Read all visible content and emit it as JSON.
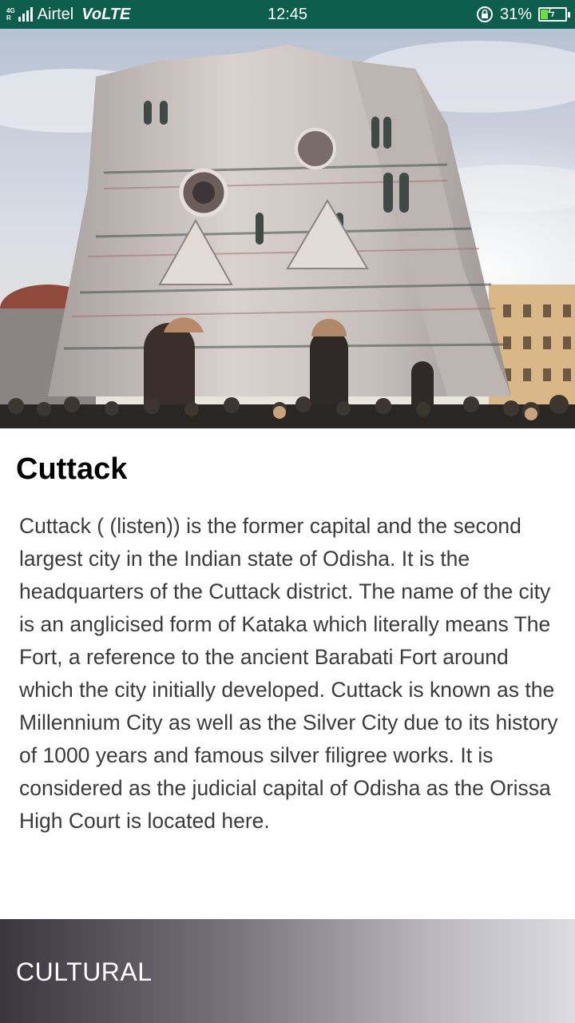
{
  "status_bar": {
    "network_type": "4G",
    "roaming_indicator": "R",
    "carrier": "Airtel",
    "volte": "VoLTE",
    "time": "12:45",
    "battery_percent": "31%",
    "battery_level": 0.31
  },
  "hero": {
    "icon": "cathedral-photo"
  },
  "place": {
    "title": "Cuttack",
    "description": "Cuttack ( (listen)) is the former capital and the second largest city in the Indian state of Odisha. It is the headquarters of the Cuttack district. The name of the city is an anglicised form of Kataka which literally means The Fort, a reference to the ancient Barabati Fort around which the city initially developed. Cuttack is known as the Millennium City as well as the Silver City due to its history of 1000 years and famous silver filigree works. It is considered as the judicial capital of Odisha as the Orissa High Court is located here."
  },
  "category": {
    "label": "CULTURAL"
  }
}
